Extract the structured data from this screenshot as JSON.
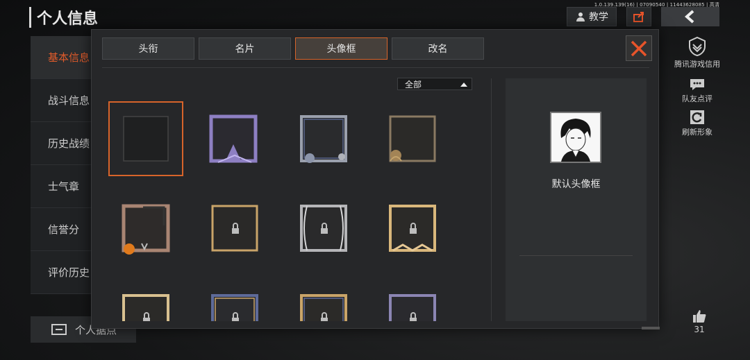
{
  "version_text": "1.0.139.139(16) | 07090540 | 11443628085 | 高清",
  "page": {
    "title": "个人信息"
  },
  "top_buttons": {
    "tutorial_label": "教学"
  },
  "left_nav": {
    "items": [
      {
        "label": "基本信息",
        "active": true
      },
      {
        "label": "战斗信息",
        "active": false
      },
      {
        "label": "历史战绩",
        "active": false
      },
      {
        "label": "士气章",
        "active": false
      },
      {
        "label": "信誉分",
        "active": false
      },
      {
        "label": "评价历史",
        "active": false
      }
    ]
  },
  "bottom_tab": {
    "label": "个人据点"
  },
  "side_items": [
    {
      "label": "腾讯游戏信用",
      "icon": "shield-icon"
    },
    {
      "label": "队友点评",
      "icon": "chat-icon"
    },
    {
      "label": "刷新形象",
      "icon": "refresh-icon"
    }
  ],
  "likes": {
    "count": "31"
  },
  "dialog": {
    "tabs": [
      {
        "label": "头衔",
        "active": false
      },
      {
        "label": "名片",
        "active": false
      },
      {
        "label": "头像框",
        "active": true
      },
      {
        "label": "改名",
        "active": false
      }
    ],
    "filter": {
      "selected": "全部"
    },
    "frames": [
      {
        "style": "empty",
        "selected": true,
        "locked": false
      },
      {
        "style": "purple",
        "locked": false
      },
      {
        "style": "silver-blue",
        "locked": false
      },
      {
        "style": "bronze-octopus",
        "locked": false
      },
      {
        "style": "halloween",
        "locked": false
      },
      {
        "style": "gold-thin",
        "locked": true
      },
      {
        "style": "silver-ornate",
        "locked": true
      },
      {
        "style": "gold-ornate",
        "locked": true
      },
      {
        "style": "gold-plain",
        "locked": true
      },
      {
        "style": "blue-gold",
        "locked": true
      },
      {
        "style": "gold-blue",
        "locked": true
      },
      {
        "style": "purple-plain",
        "locked": true
      }
    ],
    "preview": {
      "label": "默认头像框"
    }
  },
  "colors": {
    "accent": "#e25b2a",
    "close": "#e8542a"
  }
}
